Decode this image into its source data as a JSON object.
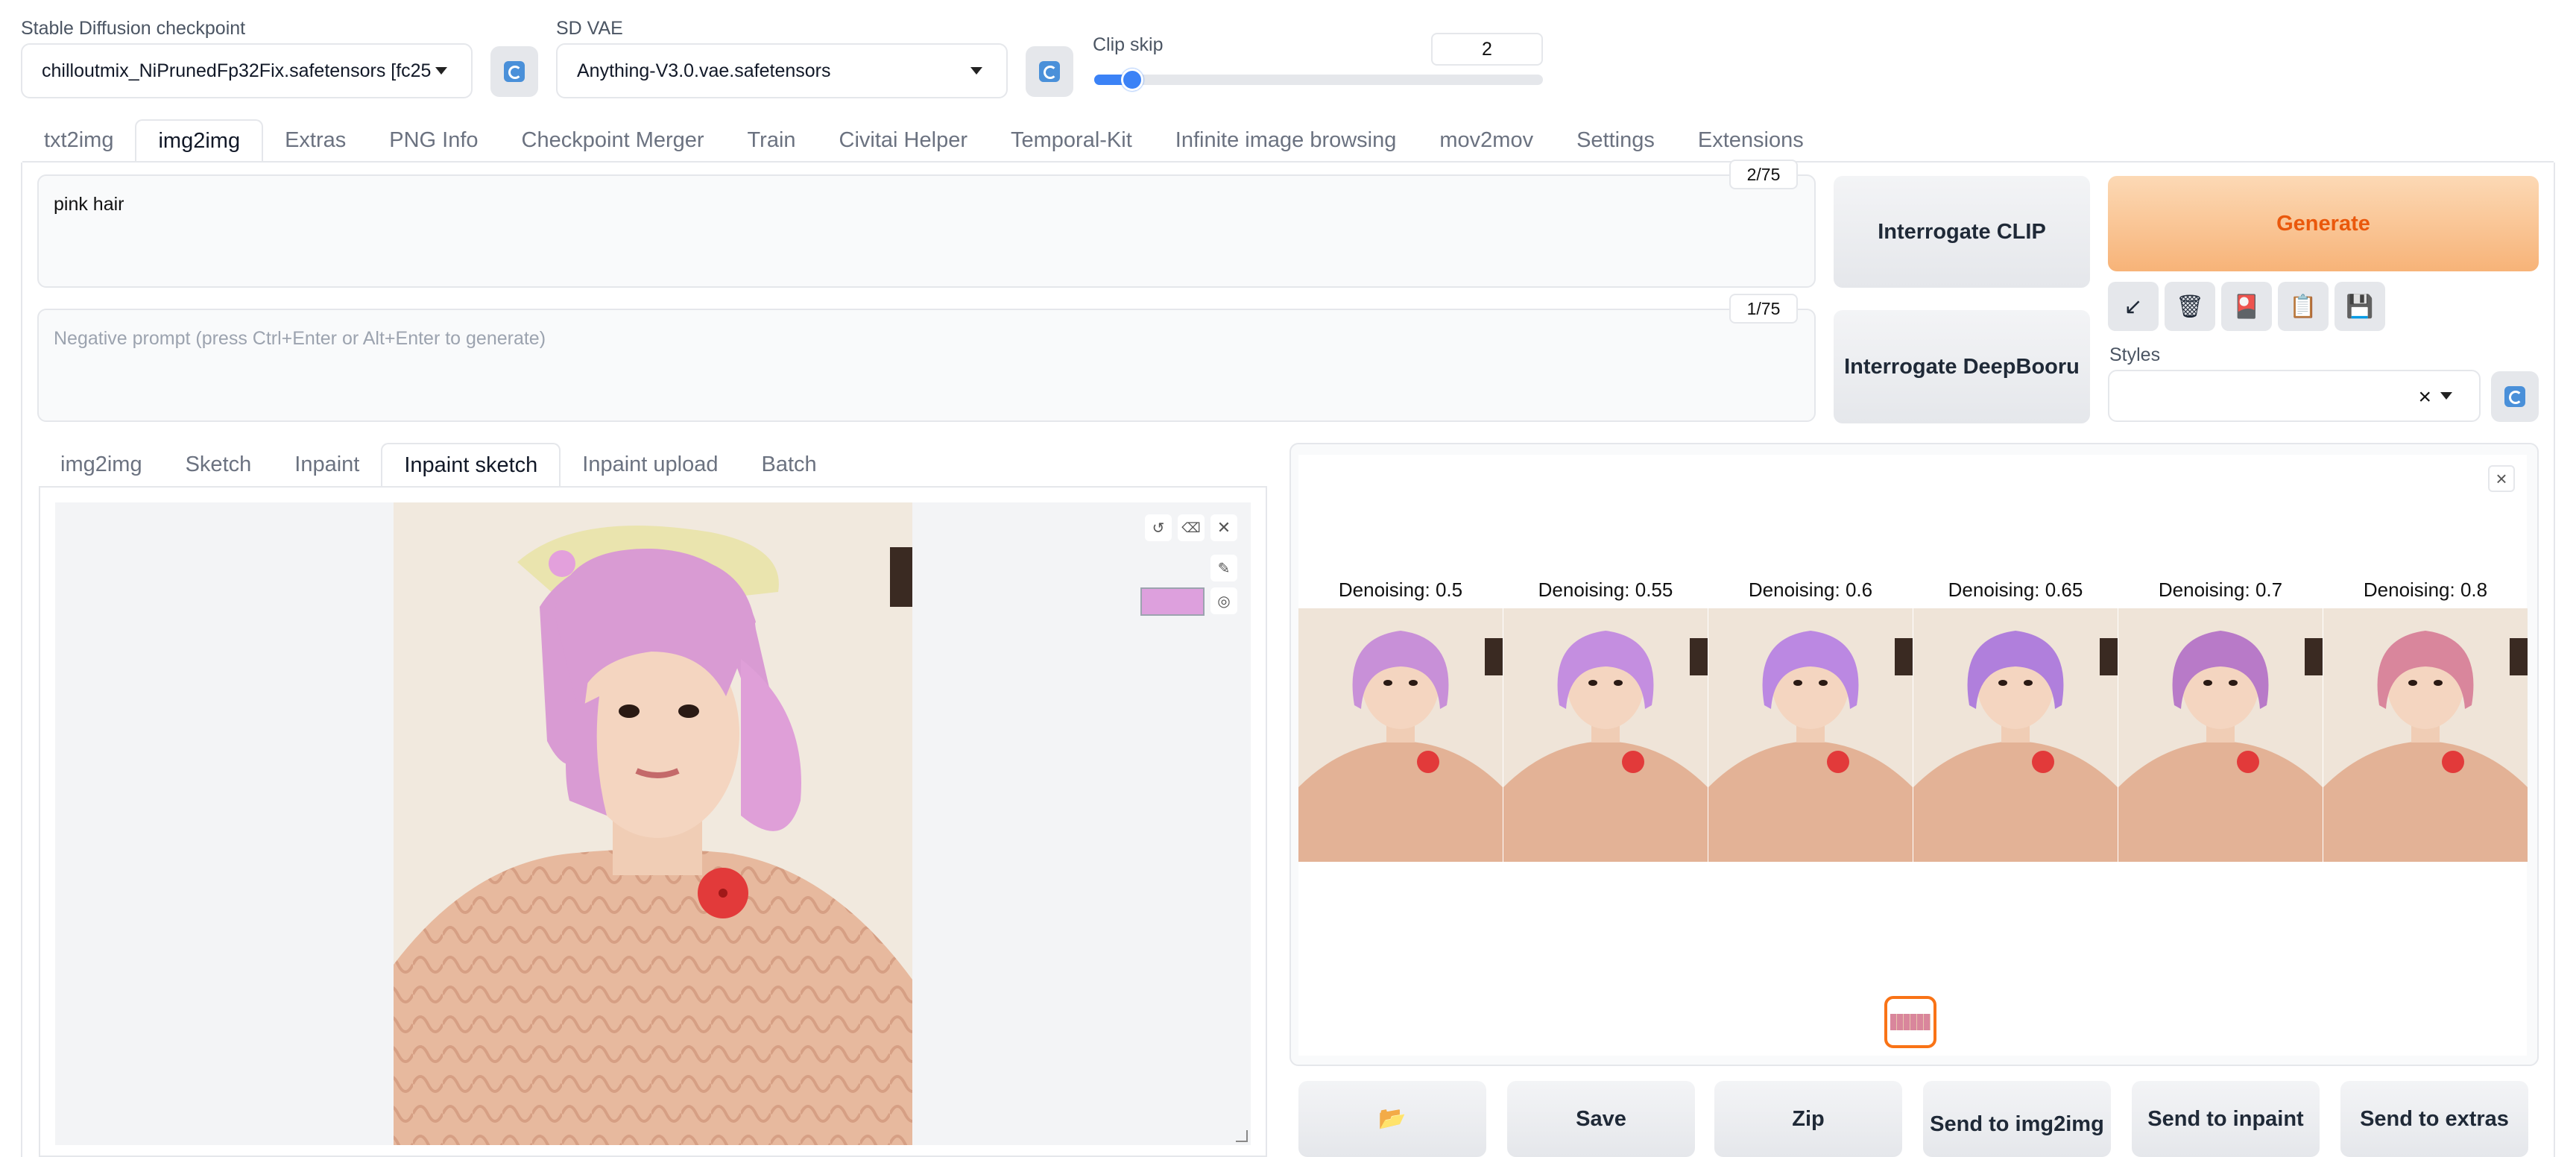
{
  "header": {
    "checkpoint_label": "Stable Diffusion checkpoint",
    "checkpoint_value": "chilloutmix_NiPrunedFp32Fix.safetensors [fc25",
    "vae_label": "SD VAE",
    "vae_value": "Anything-V3.0.vae.safetensors",
    "clip_label": "Clip skip",
    "clip_value": "2",
    "clip_slider_fraction": 0.08
  },
  "tabs": [
    "txt2img",
    "img2img",
    "Extras",
    "PNG Info",
    "Checkpoint Merger",
    "Train",
    "Civitai Helper",
    "Temporal-Kit",
    "Infinite image browsing",
    "mov2mov",
    "Settings",
    "Extensions"
  ],
  "prompt": {
    "value": "pink hair",
    "counter": "2/75",
    "negative_placeholder": "Negative prompt (press Ctrl+Enter or Alt+Enter to generate)",
    "negative_counter": "1/75"
  },
  "buttons": {
    "interrogate_clip": "Interrogate CLIP",
    "interrogate_deepbooru": "Interrogate DeepBooru",
    "generate": "Generate",
    "styles_label": "Styles",
    "styles_clear": "×"
  },
  "tool_icons": [
    "↙",
    "🗑",
    "🎴",
    "📋",
    "💾"
  ],
  "subtabs": [
    "img2img",
    "Sketch",
    "Inpaint",
    "Inpaint sketch",
    "Inpaint upload",
    "Batch"
  ],
  "brush_color": "#dda0dd",
  "gallery": {
    "labels": [
      "Denoising: 0.5",
      "Denoising: 0.55",
      "Denoising: 0.6",
      "Denoising: 0.65",
      "Denoising: 0.7",
      "Denoising: 0.8"
    ],
    "hair_colors": [
      "#c890d8",
      "#c48ee0",
      "#bb88e2",
      "#b07fdc",
      "#b87ac8",
      "#d9869c"
    ],
    "close": "×"
  },
  "bottom_buttons": {
    "folder_icon": "📂",
    "save": "Save",
    "zip": "Zip",
    "send_img2img": "Send to img2img",
    "send_inpaint": "Send to inpaint",
    "send_extras": "Send to extras"
  }
}
